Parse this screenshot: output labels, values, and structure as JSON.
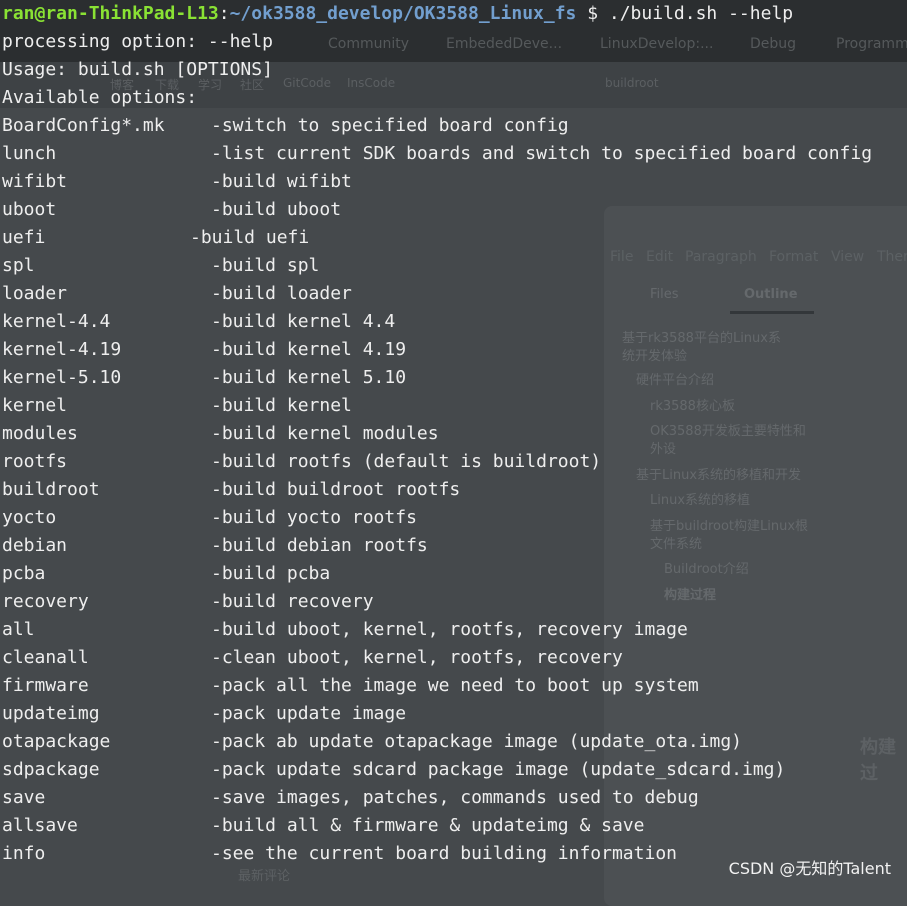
{
  "terminal": {
    "prompt_user": "ran@ran-ThinkPad-L13",
    "prompt_path": "~/ok3588_develop/OK3588_Linux_fs",
    "prompt_cmd": " $ ./build.sh --help",
    "lines": [
      "processing option: --help",
      "Usage: build.sh [OPTIONS]",
      "Available options:"
    ],
    "options": [
      {
        "name": "BoardConfig*.mk",
        "desc": "-switch to specified board config"
      },
      {
        "name": "lunch",
        "desc": "-list current SDK boards and switch to specified board config"
      },
      {
        "name": "wifibt",
        "desc": "-build wifibt"
      },
      {
        "name": "uboot",
        "desc": "-build uboot"
      },
      {
        "name": "uefi",
        "desc": "-build uefi"
      },
      {
        "name": "spl",
        "desc": "-build spl"
      },
      {
        "name": "loader",
        "desc": "-build loader"
      },
      {
        "name": "kernel-4.4",
        "desc": "-build kernel 4.4"
      },
      {
        "name": "kernel-4.19",
        "desc": "-build kernel 4.19"
      },
      {
        "name": "kernel-5.10",
        "desc": "-build kernel 5.10"
      },
      {
        "name": "kernel",
        "desc": "-build kernel"
      },
      {
        "name": "modules",
        "desc": "-build kernel modules"
      },
      {
        "name": "rootfs",
        "desc": "-build rootfs (default is buildroot)"
      },
      {
        "name": "buildroot",
        "desc": "-build buildroot rootfs"
      },
      {
        "name": "yocto",
        "desc": "-build yocto rootfs"
      },
      {
        "name": "debian",
        "desc": "-build debian rootfs"
      },
      {
        "name": "pcba",
        "desc": "-build pcba"
      },
      {
        "name": "recovery",
        "desc": "-build recovery"
      },
      {
        "name": "all",
        "desc": "-build uboot, kernel, rootfs, recovery image"
      },
      {
        "name": "cleanall",
        "desc": "-clean uboot, kernel, rootfs, recovery"
      },
      {
        "name": "firmware",
        "desc": "-pack all the image we need to boot up system"
      },
      {
        "name": "updateimg",
        "desc": "-pack update image"
      },
      {
        "name": "otapackage",
        "desc": "-pack ab update otapackage image (update_ota.img)"
      },
      {
        "name": "sdpackage",
        "desc": "-pack update sdcard package image (update_sdcard.img)"
      },
      {
        "name": "save",
        "desc": "-save images, patches, commands used to debug"
      },
      {
        "name": "allsave",
        "desc": "-build all & firmware & updateimg & save"
      },
      {
        "name": "info",
        "desc": "-see the current board building information"
      }
    ],
    "colors": {
      "user": "#8ae234",
      "path": "#729fcf",
      "text": "#eeeeee"
    }
  },
  "background": {
    "bookmarks": [
      "Community",
      "EmbededDeve...",
      "LinuxDevelop:...",
      "Debug",
      "Programm"
    ],
    "nav": [
      "博客",
      "下载",
      "学习",
      "社区",
      "GitCode",
      "InsCode"
    ],
    "search": "buildroot",
    "menu": [
      "File",
      "Edit",
      "Paragraph",
      "Format",
      "View",
      "Ther"
    ],
    "tabs": [
      "Files",
      "Outline"
    ],
    "outline": [
      "基于rk3588平台的Linux系统开发体验",
      "硬件平台介绍",
      "rk3588核心板",
      "OK3588开发板主要特性和外设",
      "基于Linux系统的移植和开发",
      "Linux系统的移植",
      "基于buildroot构建Linux根文件系统",
      "Buildroot介绍",
      "构建过程"
    ],
    "article_heading": "构建过",
    "footer_label": "最新评论"
  },
  "watermark": "CSDN @无知的Talent"
}
